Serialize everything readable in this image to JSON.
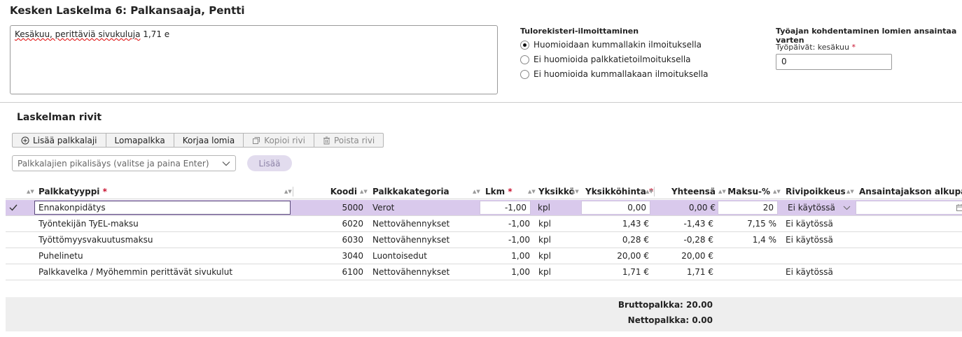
{
  "page_title": "Kesken Laskelma 6: Palkansaaja, Pentti",
  "notes": {
    "spelled_part": "Kesäkuu, perittäviä sivukuluja",
    "rest": " 1,71 e"
  },
  "income_register": {
    "title": "Tulorekisteri-ilmoittaminen",
    "options": [
      {
        "label": "Huomioidaan kummallakin ilmoituksella",
        "selected": true
      },
      {
        "label": "Ei huomioida palkkatietoilmoituksella",
        "selected": false
      },
      {
        "label": "Ei huomioida kummallakaan ilmoituksella",
        "selected": false
      }
    ]
  },
  "work_time": {
    "title": "Työajan kohdentaminen lomien ansaintaa varten",
    "field_label": "Työpäivät: kesäkuu",
    "required_mark": "*",
    "value": "0"
  },
  "rows_section": {
    "title": "Laskelman rivit",
    "toolbar": {
      "add_wage_type": "Lisää palkkalaji",
      "holiday_pay": "Lomapalkka",
      "fix_holidays": "Korjaa lomia",
      "copy_row": "Kopioi rivi",
      "delete_row": "Poista rivi"
    },
    "quick_add_placeholder": "Palkkalajien pikalisäys (valitse ja paina Enter)",
    "add_button": "Lisää"
  },
  "table": {
    "headers": {
      "type": "Palkkatyyppi",
      "code": "Koodi",
      "category": "Palkkakategoria",
      "qty": "Lkm",
      "unit": "Yksikkö",
      "unit_price": "Yksikköhinta",
      "total": "Yhteensä",
      "pct": "Maksu-%",
      "exception": "Rivipoikkeus",
      "period_start": "Ansaintajakson alkupäivä"
    },
    "required_mark": "*",
    "rows": [
      {
        "type": "Ennakonpidätys",
        "code": "5000",
        "category": "Verot",
        "qty": "-1,00",
        "unit": "kpl",
        "unit_price": "0,00",
        "total": "0,00 €",
        "pct": "20",
        "exception": "Ei käytössä",
        "selected": true
      },
      {
        "type": "Työntekijän TyEL-maksu",
        "code": "6020",
        "category": "Nettovähennykset",
        "qty": "-1,00",
        "unit": "kpl",
        "unit_price": "1,43 €",
        "total": "-1,43 €",
        "pct": "7,15 %",
        "exception": "Ei käytössä"
      },
      {
        "type": "Työttömyysvakuutusmaksu",
        "code": "6030",
        "category": "Nettovähennykset",
        "qty": "-1,00",
        "unit": "kpl",
        "unit_price": "0,28 €",
        "total": "-0,28 €",
        "pct": "1,4 %",
        "exception": "Ei käytössä"
      },
      {
        "type": "Puhelinetu",
        "code": "3040",
        "category": "Luontoisedut",
        "qty": "1,00",
        "unit": "kpl",
        "unit_price": "20,00 €",
        "total": "20,00 €",
        "pct": "",
        "exception": ""
      },
      {
        "type": "Palkkavelka / Myöhemmin perittävät sivukulut",
        "code": "6100",
        "category": "Nettovähennykset",
        "qty": "1,00",
        "unit": "kpl",
        "unit_price": "1,71 €",
        "total": "1,71 €",
        "pct": "",
        "exception": "Ei käytössä"
      }
    ]
  },
  "totals": {
    "gross": "Bruttopalkka: 20.00",
    "net": "Nettopalkka: 0.00"
  }
}
